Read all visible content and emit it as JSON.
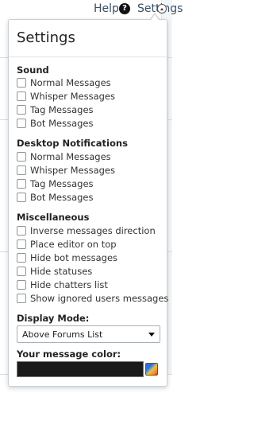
{
  "topbar": {
    "help_label": "Help",
    "settings_label": "Settings"
  },
  "panel": {
    "title": "Settings",
    "sections": {
      "sound": {
        "heading": "Sound",
        "options": [
          "Normal Messages",
          "Whisper Messages",
          "Tag Messages",
          "Bot Messages"
        ]
      },
      "desktop": {
        "heading": "Desktop Notifications",
        "options": [
          "Normal Messages",
          "Whisper Messages",
          "Tag Messages",
          "Bot Messages"
        ]
      },
      "misc": {
        "heading": "Miscellaneous",
        "options": [
          "Inverse messages direction",
          "Place editor on top",
          "Hide bot messages",
          "Hide statuses",
          "Hide chatters list",
          "Show ignored users messages"
        ]
      }
    },
    "display_mode": {
      "label": "Display Mode:",
      "selected": "Above Forums List"
    },
    "message_color": {
      "label": "Your message color:",
      "value_color": "#1a1a1a"
    }
  },
  "icons": {
    "help": "question-circle-icon",
    "settings": "chevron-up-circle-icon",
    "color_picker": "color-palette-icon"
  }
}
